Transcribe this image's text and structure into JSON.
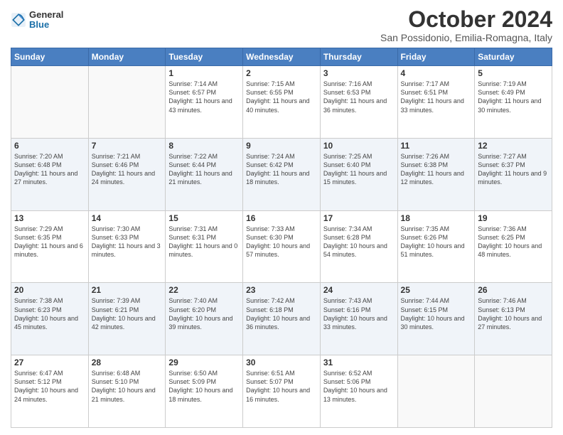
{
  "header": {
    "logo_line1": "General",
    "logo_line2": "Blue",
    "title": "October 2024",
    "subtitle": "San Possidonio, Emilia-Romagna, Italy"
  },
  "days_of_week": [
    "Sunday",
    "Monday",
    "Tuesday",
    "Wednesday",
    "Thursday",
    "Friday",
    "Saturday"
  ],
  "weeks": [
    [
      {
        "day": "",
        "text": ""
      },
      {
        "day": "",
        "text": ""
      },
      {
        "day": "1",
        "text": "Sunrise: 7:14 AM\nSunset: 6:57 PM\nDaylight: 11 hours and 43 minutes."
      },
      {
        "day": "2",
        "text": "Sunrise: 7:15 AM\nSunset: 6:55 PM\nDaylight: 11 hours and 40 minutes."
      },
      {
        "day": "3",
        "text": "Sunrise: 7:16 AM\nSunset: 6:53 PM\nDaylight: 11 hours and 36 minutes."
      },
      {
        "day": "4",
        "text": "Sunrise: 7:17 AM\nSunset: 6:51 PM\nDaylight: 11 hours and 33 minutes."
      },
      {
        "day": "5",
        "text": "Sunrise: 7:19 AM\nSunset: 6:49 PM\nDaylight: 11 hours and 30 minutes."
      }
    ],
    [
      {
        "day": "6",
        "text": "Sunrise: 7:20 AM\nSunset: 6:48 PM\nDaylight: 11 hours and 27 minutes."
      },
      {
        "day": "7",
        "text": "Sunrise: 7:21 AM\nSunset: 6:46 PM\nDaylight: 11 hours and 24 minutes."
      },
      {
        "day": "8",
        "text": "Sunrise: 7:22 AM\nSunset: 6:44 PM\nDaylight: 11 hours and 21 minutes."
      },
      {
        "day": "9",
        "text": "Sunrise: 7:24 AM\nSunset: 6:42 PM\nDaylight: 11 hours and 18 minutes."
      },
      {
        "day": "10",
        "text": "Sunrise: 7:25 AM\nSunset: 6:40 PM\nDaylight: 11 hours and 15 minutes."
      },
      {
        "day": "11",
        "text": "Sunrise: 7:26 AM\nSunset: 6:38 PM\nDaylight: 11 hours and 12 minutes."
      },
      {
        "day": "12",
        "text": "Sunrise: 7:27 AM\nSunset: 6:37 PM\nDaylight: 11 hours and 9 minutes."
      }
    ],
    [
      {
        "day": "13",
        "text": "Sunrise: 7:29 AM\nSunset: 6:35 PM\nDaylight: 11 hours and 6 minutes."
      },
      {
        "day": "14",
        "text": "Sunrise: 7:30 AM\nSunset: 6:33 PM\nDaylight: 11 hours and 3 minutes."
      },
      {
        "day": "15",
        "text": "Sunrise: 7:31 AM\nSunset: 6:31 PM\nDaylight: 11 hours and 0 minutes."
      },
      {
        "day": "16",
        "text": "Sunrise: 7:33 AM\nSunset: 6:30 PM\nDaylight: 10 hours and 57 minutes."
      },
      {
        "day": "17",
        "text": "Sunrise: 7:34 AM\nSunset: 6:28 PM\nDaylight: 10 hours and 54 minutes."
      },
      {
        "day": "18",
        "text": "Sunrise: 7:35 AM\nSunset: 6:26 PM\nDaylight: 10 hours and 51 minutes."
      },
      {
        "day": "19",
        "text": "Sunrise: 7:36 AM\nSunset: 6:25 PM\nDaylight: 10 hours and 48 minutes."
      }
    ],
    [
      {
        "day": "20",
        "text": "Sunrise: 7:38 AM\nSunset: 6:23 PM\nDaylight: 10 hours and 45 minutes."
      },
      {
        "day": "21",
        "text": "Sunrise: 7:39 AM\nSunset: 6:21 PM\nDaylight: 10 hours and 42 minutes."
      },
      {
        "day": "22",
        "text": "Sunrise: 7:40 AM\nSunset: 6:20 PM\nDaylight: 10 hours and 39 minutes."
      },
      {
        "day": "23",
        "text": "Sunrise: 7:42 AM\nSunset: 6:18 PM\nDaylight: 10 hours and 36 minutes."
      },
      {
        "day": "24",
        "text": "Sunrise: 7:43 AM\nSunset: 6:16 PM\nDaylight: 10 hours and 33 minutes."
      },
      {
        "day": "25",
        "text": "Sunrise: 7:44 AM\nSunset: 6:15 PM\nDaylight: 10 hours and 30 minutes."
      },
      {
        "day": "26",
        "text": "Sunrise: 7:46 AM\nSunset: 6:13 PM\nDaylight: 10 hours and 27 minutes."
      }
    ],
    [
      {
        "day": "27",
        "text": "Sunrise: 6:47 AM\nSunset: 5:12 PM\nDaylight: 10 hours and 24 minutes."
      },
      {
        "day": "28",
        "text": "Sunrise: 6:48 AM\nSunset: 5:10 PM\nDaylight: 10 hours and 21 minutes."
      },
      {
        "day": "29",
        "text": "Sunrise: 6:50 AM\nSunset: 5:09 PM\nDaylight: 10 hours and 18 minutes."
      },
      {
        "day": "30",
        "text": "Sunrise: 6:51 AM\nSunset: 5:07 PM\nDaylight: 10 hours and 16 minutes."
      },
      {
        "day": "31",
        "text": "Sunrise: 6:52 AM\nSunset: 5:06 PM\nDaylight: 10 hours and 13 minutes."
      },
      {
        "day": "",
        "text": ""
      },
      {
        "day": "",
        "text": ""
      }
    ]
  ]
}
